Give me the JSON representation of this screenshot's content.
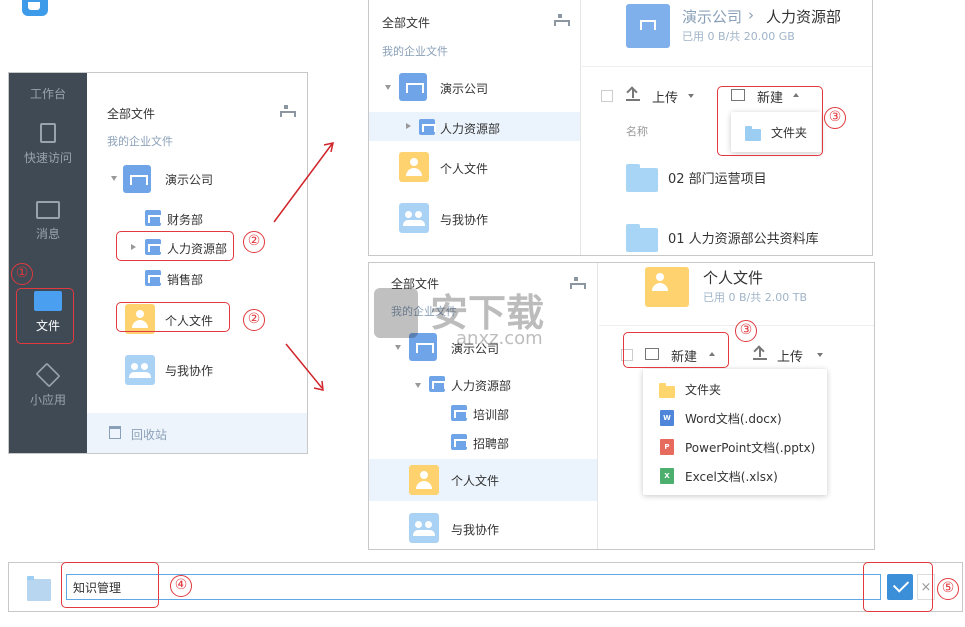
{
  "panel1": {
    "sidebar": [
      {
        "label": "工作台",
        "icon": "workbench-icon"
      },
      {
        "label": "快速访问",
        "icon": "quick-access-icon"
      },
      {
        "label": "消息",
        "icon": "message-icon"
      },
      {
        "label": "文件",
        "icon": "file-icon"
      },
      {
        "label": "小应用",
        "icon": "apps-icon"
      }
    ],
    "all_files": "全部文件",
    "my_enterprise": "我的企业文件",
    "company": "演示公司",
    "depts": [
      "财务部",
      "人力资源部",
      "销售部"
    ],
    "personal": "个人文件",
    "shared": "与我协作",
    "recycle": "回收站"
  },
  "panel2": {
    "all_files": "全部文件",
    "my_enterprise": "我的企业文件",
    "company": "演示公司",
    "dept": "人力资源部",
    "personal": "个人文件",
    "shared": "与我协作",
    "breadcrumb_root": "演示公司",
    "breadcrumb_sep": "›",
    "breadcrumb_current": "人力资源部",
    "quota": "已用 0 B/共 20.00 GB",
    "upload": "上传",
    "new": "新建",
    "name_col": "名称",
    "dropdown_folder": "文件夹",
    "files": [
      "02 部门运营项目",
      "01 人力资源部公共资料库"
    ]
  },
  "panel3": {
    "all_files": "全部文件",
    "my_enterprise": "我的企业文件",
    "company": "演示公司",
    "dept": "人力资源部",
    "subdepts": [
      "培训部",
      "招聘部"
    ],
    "personal": "个人文件",
    "shared": "与我协作",
    "title": "个人文件",
    "quota": "已用 0 B/共 2.00 TB",
    "new": "新建",
    "upload": "上传",
    "menu": [
      {
        "label": "文件夹",
        "badge": "",
        "color": "#ffd66e"
      },
      {
        "label": "Word文档(.docx)",
        "badge": "W",
        "color": "#4f86d9"
      },
      {
        "label": "PowerPoint文档(.pptx)",
        "badge": "P",
        "color": "#e76b5c"
      },
      {
        "label": "Excel文档(.xlsx)",
        "badge": "X",
        "color": "#4caf6e"
      }
    ]
  },
  "bottom": {
    "folder_name": "知识管理"
  },
  "steps": [
    "①",
    "②",
    "②",
    "③",
    "③",
    "④",
    "⑤"
  ],
  "watermark": "安下载",
  "watermark_url": "anxz.com"
}
